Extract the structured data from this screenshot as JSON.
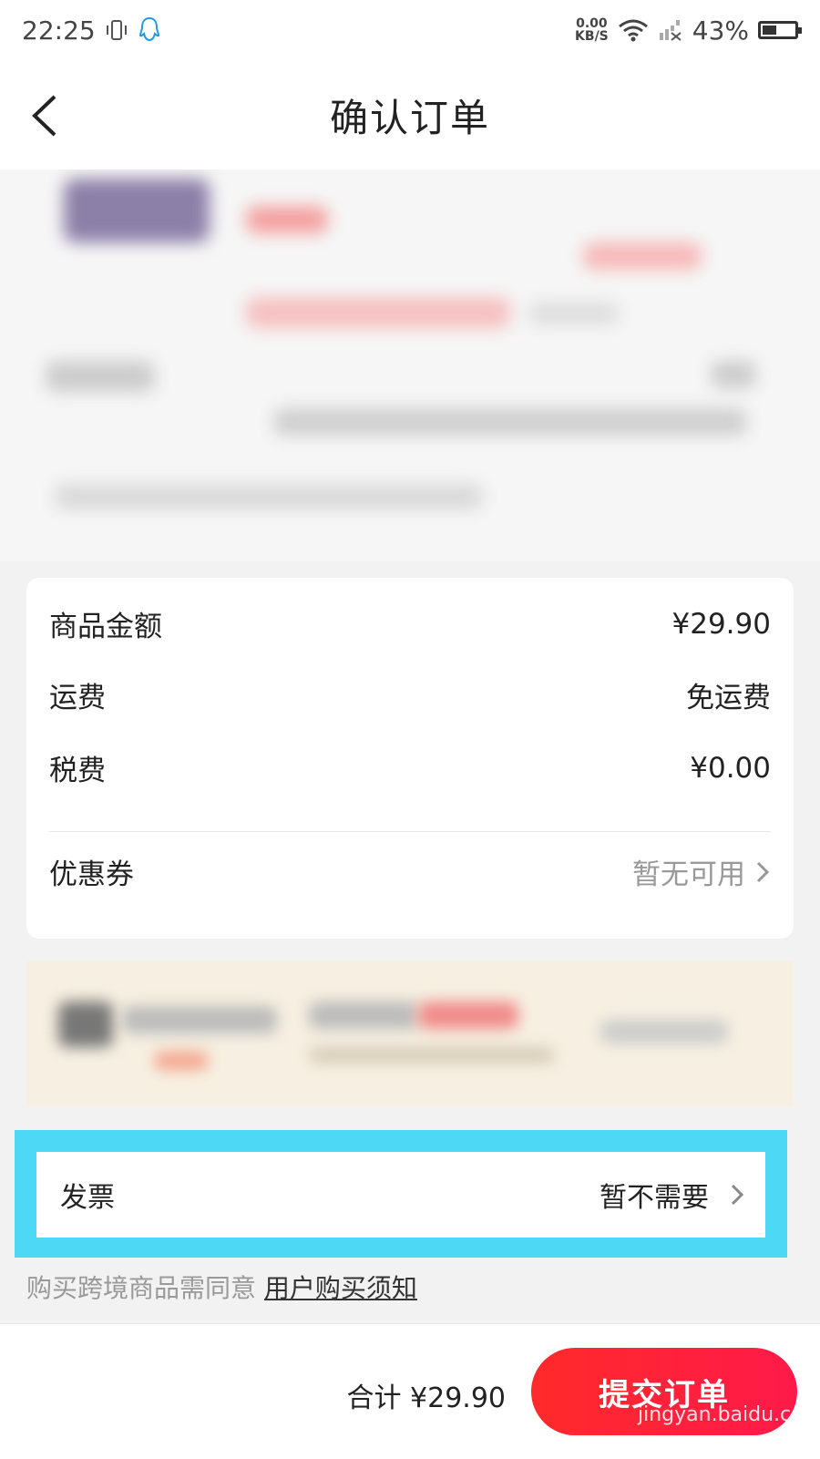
{
  "status_bar": {
    "time": "22:25",
    "net_speed_value": "0.00",
    "net_speed_unit": "KB/S",
    "battery": "43%",
    "battery_level": 0.43
  },
  "nav": {
    "title": "确认订单"
  },
  "price_summary": {
    "rows": [
      {
        "label": "商品金额",
        "value": "¥29.90"
      },
      {
        "label": "运费",
        "value": "免运费"
      },
      {
        "label": "税费",
        "value": "¥0.00"
      }
    ],
    "coupon": {
      "label": "优惠券",
      "value": "暂无可用"
    }
  },
  "invoice": {
    "label": "发票",
    "value": "暂不需要"
  },
  "notice": {
    "text": "购买跨境商品需同意",
    "link": "用户购买须知"
  },
  "footer": {
    "total": "合计 ¥29.90",
    "submit": "提交订单"
  },
  "watermark": "jingyan.baidu.com",
  "colors": {
    "accent": "#ff2a2a",
    "highlight": "#4dd9f5"
  }
}
